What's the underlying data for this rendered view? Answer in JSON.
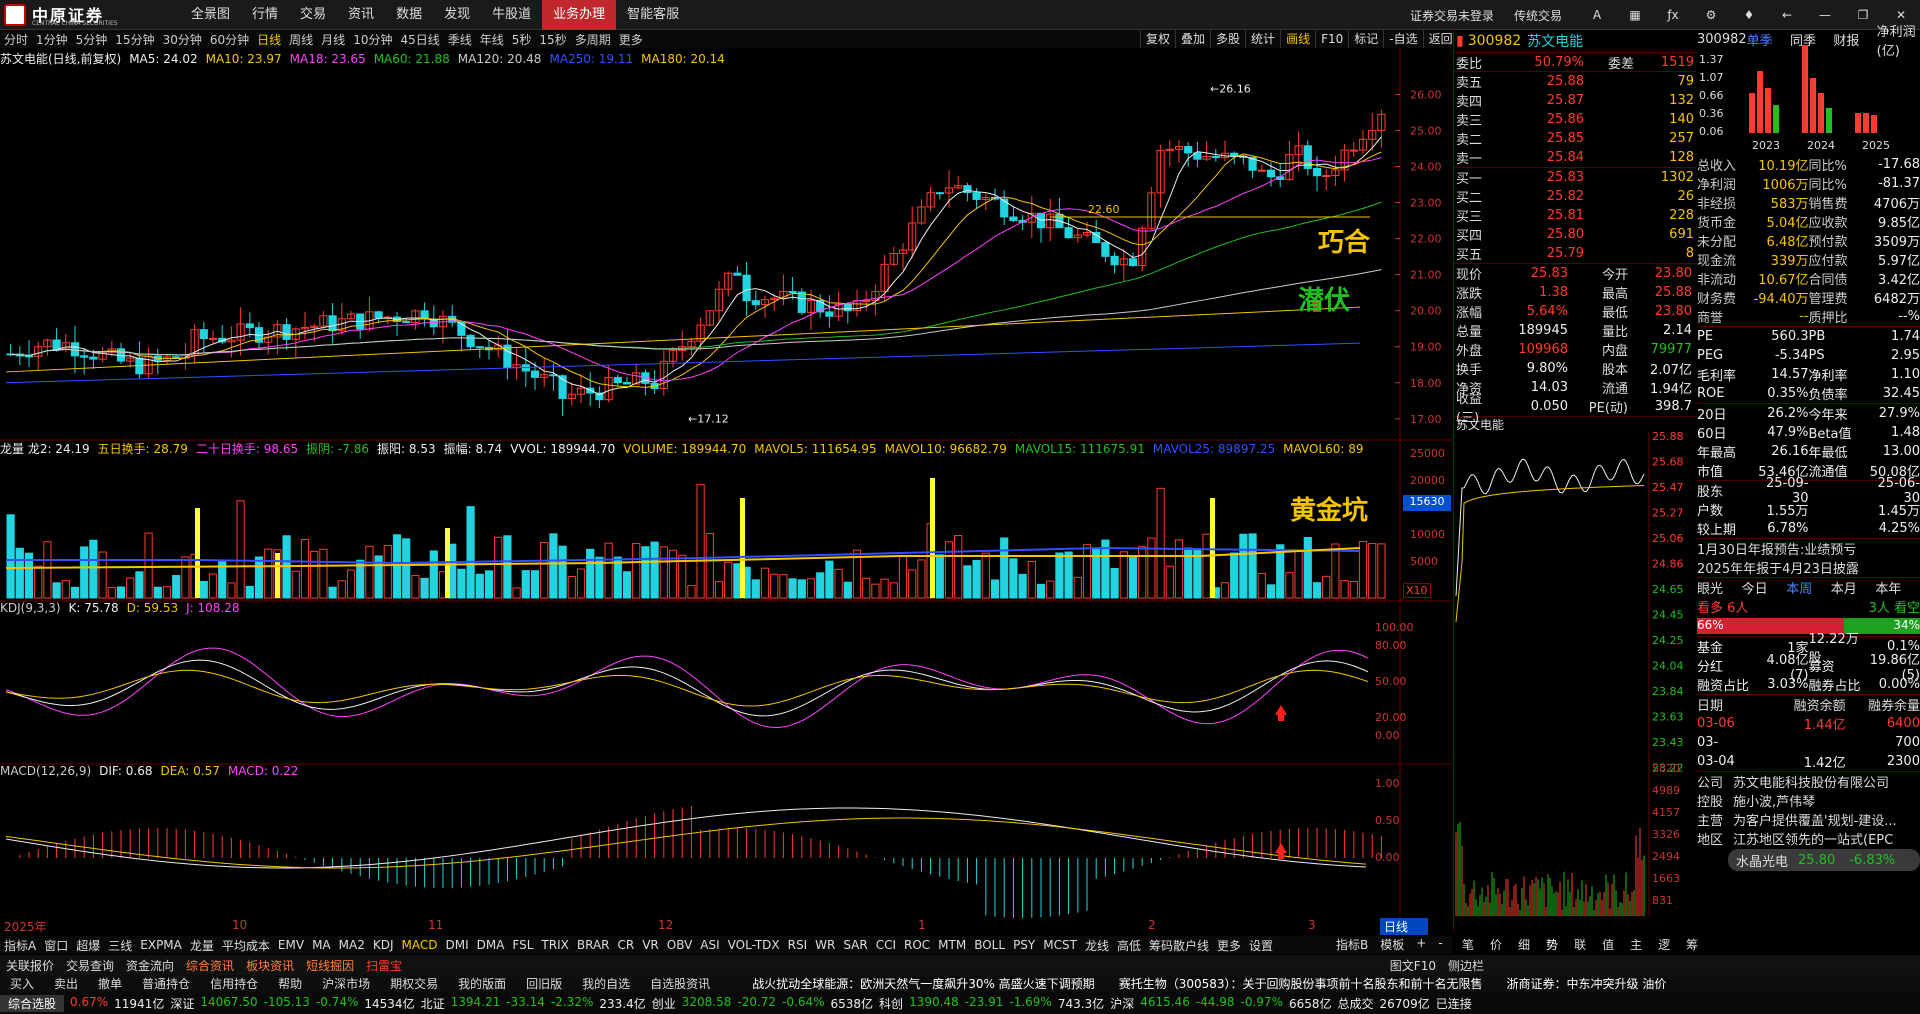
{
  "app": {
    "brand": "中原证券",
    "brand_en": "CENTRAL CHINA SECURITIES"
  },
  "menu": [
    "全景图",
    "行情",
    "交易",
    "资讯",
    "数据",
    "发现",
    "牛股道",
    "业务办理",
    "智能客服"
  ],
  "menu_active": 7,
  "top_right": {
    "login": "证券交易未登录",
    "trad": "传统交易",
    "icons": [
      "font-size-icon",
      "grid-icon",
      "formula-icon",
      "settings-icon",
      "theme-icon",
      "back-icon",
      "minimize-icon",
      "restore-icon",
      "close-icon"
    ]
  },
  "periods": [
    "分时",
    "1分钟",
    "5分钟",
    "15分钟",
    "30分钟",
    "60分钟",
    "日线",
    "周线",
    "月线",
    "10分钟",
    "45日线",
    "季线",
    "年线",
    "5秒",
    "15秒",
    "多周期",
    "更多"
  ],
  "period_active": "日线",
  "toolbtns": [
    "复权",
    "叠加",
    "多股",
    "统计",
    "画线",
    "F10",
    "标记",
    "-自选",
    "返回"
  ],
  "ma_line": {
    "title": "苏文电能(日线,前复权)",
    "items": [
      {
        "t": "MA5: 24.02",
        "c": "#eee"
      },
      {
        "t": "MA10: 23.97",
        "c": "#f5c400"
      },
      {
        "t": "MA18: 23.65",
        "c": "#ff40ff"
      },
      {
        "t": "MA60: 21.88",
        "c": "#20c020"
      },
      {
        "t": "MA120: 20.48",
        "c": "#ccc"
      },
      {
        "t": "MA250: 19.11",
        "c": "#3050ff"
      },
      {
        "t": "MA180: 20.14",
        "c": "#f5c400"
      }
    ]
  },
  "price_axis": [
    "26.00",
    "25.00",
    "24.00",
    "23.00",
    "22.00",
    "21.00",
    "20.00",
    "19.00",
    "18.00",
    "17.00"
  ],
  "annotations": {
    "high": "26.16",
    "low": "17.12",
    "mid": "22.60",
    "qiaohe": "巧合",
    "qianfu": "潜伏",
    "huangjinkeng": "黄金坑",
    "vol_mark": "15630",
    "x10": "X10"
  },
  "vol_line": {
    "items": [
      {
        "t": "龙量 龙2: 24.19",
        "c": "#eee"
      },
      {
        "t": "五日换手: 28.79",
        "c": "#f5c400"
      },
      {
        "t": "二十日换手: 98.65",
        "c": "#ff40ff"
      },
      {
        "t": "振阴: -7.86",
        "c": "#20c020"
      },
      {
        "t": "振阳: 8.53",
        "c": "#eee"
      },
      {
        "t": "振幅: 8.74",
        "c": "#eee"
      },
      {
        "t": "VVOL: 189944.70",
        "c": "#eee"
      },
      {
        "t": "VOLUME: 189944.70",
        "c": "#f5c400"
      },
      {
        "t": "MAVOL5: 111654.95",
        "c": "#f5c400"
      },
      {
        "t": "MAVOL10: 96682.79",
        "c": "#f5c400"
      },
      {
        "t": "MAVOL15: 111675.91",
        "c": "#20c020"
      },
      {
        "t": "MAVOL25: 89897.25",
        "c": "#3050ff"
      },
      {
        "t": "MAVOL60: 89",
        "c": "#f5c400"
      }
    ]
  },
  "vol_axis": [
    "25000",
    "20000",
    "15000",
    "10000",
    "5000"
  ],
  "kdj_line": {
    "items": [
      {
        "t": "KDJ(9,3,3)",
        "c": "#ccc"
      },
      {
        "t": "K: 75.78",
        "c": "#eee"
      },
      {
        "t": "D: 59.53",
        "c": "#f5c400"
      },
      {
        "t": "J: 108.28",
        "c": "#ff40ff"
      }
    ]
  },
  "kdj_axis": [
    "100.00",
    "80.00",
    "50.00",
    "20.00",
    "0.00"
  ],
  "macd_line": {
    "items": [
      {
        "t": "MACD(12,26,9)",
        "c": "#ccc"
      },
      {
        "t": "DIF: 0.68",
        "c": "#eee"
      },
      {
        "t": "DEA: 0.57",
        "c": "#f5c400"
      },
      {
        "t": "MACD: 0.22",
        "c": "#ff40ff"
      }
    ]
  },
  "macd_axis": [
    "1.00",
    "0.50",
    "0.00"
  ],
  "time_axis": [
    "2025年",
    "10",
    "11",
    "12",
    "1",
    "2",
    "3"
  ],
  "stock": {
    "code": "300982",
    "name": "苏文电能"
  },
  "order": {
    "weibi_l": "委比",
    "weibi": "50.79%",
    "weicha_l": "委差",
    "weicha": "1519",
    "sell": [
      [
        "卖五",
        "25.88",
        "79"
      ],
      [
        "卖四",
        "25.87",
        "132"
      ],
      [
        "卖三",
        "25.86",
        "140"
      ],
      [
        "卖二",
        "25.85",
        "257"
      ],
      [
        "卖一",
        "25.84",
        "128"
      ]
    ],
    "buy": [
      [
        "买一",
        "25.83",
        "1302"
      ],
      [
        "买二",
        "25.82",
        "26"
      ],
      [
        "买三",
        "25.81",
        "228"
      ],
      [
        "买四",
        "25.80",
        "691"
      ],
      [
        "买五",
        "25.79",
        "8"
      ]
    ]
  },
  "stats": [
    [
      "现价",
      "25.83",
      "今开",
      "23.80"
    ],
    [
      "涨跌",
      "1.38",
      "最高",
      "25.88"
    ],
    [
      "涨幅",
      "5.64%",
      "最低",
      "23.80"
    ],
    [
      "总量",
      "189945",
      "量比",
      "2.14"
    ],
    [
      "外盘",
      "109968",
      "内盘",
      "79977"
    ],
    [
      "换手",
      "9.80%",
      "股本",
      "2.07亿"
    ],
    [
      "净资",
      "14.03",
      "流通",
      "1.94亿"
    ],
    [
      "收益(三)",
      "0.050",
      "PE(动)",
      "398.7"
    ]
  ],
  "intraday": {
    "title": "苏文电能",
    "axis": [
      "25.88",
      "25.68",
      "25.47",
      "25.27",
      "25.06",
      "24.86",
      "24.65",
      "24.45",
      "24.25",
      "24.04",
      "23.84",
      "23.63",
      "23.43",
      "23.22"
    ],
    "vol_axis": [
      "5820",
      "4989",
      "4157",
      "3326",
      "2494",
      "1663",
      "831"
    ]
  },
  "fin": {
    "code": "300982",
    "tabs": [
      "单季",
      "同季",
      "财报",
      "净利润(亿)"
    ],
    "chart_y": [
      "1.37",
      "1.07",
      "0.66",
      "0.36",
      "0.06"
    ],
    "chart_x": [
      "2023",
      "2024",
      "2025"
    ],
    "rows1": [
      [
        "总收入",
        "10.19亿",
        "同比%",
        "-17.68"
      ],
      [
        "净利润",
        "1006万",
        "同比%",
        "-81.37"
      ],
      [
        "非经损",
        "583万",
        "销售费",
        "4706万"
      ],
      [
        "货币金",
        "5.04亿",
        "应收款",
        "9.85亿"
      ],
      [
        "未分配",
        "6.48亿",
        "预付款",
        "3509万"
      ],
      [
        "现金流",
        "339万",
        "应付款",
        "5.97亿"
      ],
      [
        "非流动",
        "10.67亿",
        "合同债",
        "3.42亿"
      ],
      [
        "财务费",
        "-94.40万",
        "管理费",
        "6482万"
      ],
      [
        "商誉",
        "--",
        "质押比",
        "--%"
      ]
    ],
    "rows2": [
      [
        "PE",
        "560.3",
        "PB",
        "1.74"
      ],
      [
        "PEG",
        "-5.34",
        "PS",
        "2.95"
      ],
      [
        "毛利率",
        "14.57",
        "净利率",
        "1.10"
      ],
      [
        "ROE",
        "0.35%",
        "负债率",
        "32.45"
      ]
    ],
    "rows3": [
      [
        "20日",
        "26.2%",
        "今年来",
        "27.9%"
      ],
      [
        "60日",
        "47.9%",
        "Beta值",
        "1.48"
      ],
      [
        "年最高",
        "26.16",
        "年最低",
        "13.00"
      ],
      [
        "市值",
        "53.46亿",
        "流通值",
        "50.08亿"
      ]
    ],
    "rows4": [
      [
        "股东",
        "25-09-30",
        "",
        "25-06-30"
      ],
      [
        "户数",
        "1.55万",
        "",
        "1.45万"
      ],
      [
        "较上期",
        "6.78%",
        "",
        "4.25%"
      ]
    ],
    "notice": [
      "1月30日年报预告:业绩预亏",
      "2025年年报于4月23日披露"
    ],
    "yanguang": {
      "label": "眼光",
      "tabs": [
        "今日",
        "本周",
        "本月",
        "本年"
      ],
      "kanduo": "看多 6人",
      "kankong": "3人 看空",
      "pct_up": "66%",
      "pct_down": "34%",
      "pct_up_val": 66
    },
    "rows5": [
      [
        "基金",
        "1家",
        "12.22万股",
        "0.1%"
      ],
      [
        "分红",
        "4.08亿(7)",
        "募资",
        "19.86亿(5)"
      ],
      [
        "融资占比",
        "3.03%",
        "融券占比",
        "0.00%"
      ]
    ],
    "margin_head": [
      "日期",
      "融资余额",
      "融券余量"
    ],
    "margin": [
      [
        "03-06",
        "1.44亿",
        "6400"
      ],
      [
        "03-",
        "",
        "700"
      ],
      [
        "03-04",
        "1.42亿",
        "2300"
      ]
    ],
    "popup": {
      "name": "水晶光电",
      "price": "25.80",
      "chg": "-6.83%"
    },
    "company": [
      [
        "公司",
        "苏文电能科技股份有限公司"
      ],
      [
        "控股",
        "施小波,芦伟琴"
      ],
      [
        "主营",
        "为客户提供覆盖'规划-建设..."
      ],
      [
        "地区",
        "江苏地区领先的一站式(EPC"
      ]
    ]
  },
  "bottom_tabs": [
    "指标A",
    "窗口",
    "超爆",
    "三线",
    "EXPMA",
    "龙量",
    "平均成本",
    "EMV",
    "MA",
    "MA2",
    "KDJ",
    "MACD",
    "DMI",
    "DMA",
    "FSL",
    "TRIX",
    "BRAR",
    "CR",
    "VR",
    "OBV",
    "ASI",
    "VOL-TDX",
    "RSI",
    "WR",
    "SAR",
    "CCI",
    "ROC",
    "MTM",
    "BOLL",
    "PSY",
    "MCST",
    "龙线",
    "高低",
    "筹码散户线",
    "更多",
    "设置"
  ],
  "bottom_tab_active": "MACD",
  "bottom_right": [
    "指标B",
    "模板",
    "+",
    "-"
  ],
  "right_tabs": [
    "笔",
    "价",
    "细",
    "势",
    "联",
    "值",
    "主",
    "逻",
    "筹"
  ],
  "func_links": [
    "关联报价",
    "交易查询",
    "资金流向",
    "综合资讯",
    "板块资讯",
    "短线掘因",
    "扫雷宝"
  ],
  "func_right": [
    "图文F10",
    "侧边栏"
  ],
  "toolbar2": [
    "买入",
    "卖出",
    "撤单",
    "普通持仓",
    "信用持仓",
    "帮助",
    "沪深市场",
    "期权交易",
    "我的版面",
    "回旧版",
    "我的自选",
    "自选股资讯"
  ],
  "news": [
    "战火扰动全球能源：欧洲天然气一度飙升30% 高盛火速下调预期",
    "赛托生物（300583）：关于回购股份事项前十名股东和前十名无限售",
    "浙商证券：中东冲突升级 油价"
  ],
  "day_label": "日线",
  "status": {
    "label": "综合选股",
    "items": [
      {
        "t": "0.67%",
        "c": "#ff3b30"
      },
      {
        "t": "11941亿",
        "c": "#eee"
      },
      {
        "t": "深证",
        "c": "#eee"
      },
      {
        "t": "14067.50",
        "c": "#20c020"
      },
      {
        "t": "-105.13",
        "c": "#20c020"
      },
      {
        "t": "-0.74%",
        "c": "#20c020"
      },
      {
        "t": "14534亿",
        "c": "#eee"
      },
      {
        "t": "北证",
        "c": "#eee"
      },
      {
        "t": "1394.21",
        "c": "#20c020"
      },
      {
        "t": "-33.14",
        "c": "#20c020"
      },
      {
        "t": "-2.32%",
        "c": "#20c020"
      },
      {
        "t": "233.4亿",
        "c": "#eee"
      },
      {
        "t": "创业",
        "c": "#eee"
      },
      {
        "t": "3208.58",
        "c": "#20c020"
      },
      {
        "t": "-20.72",
        "c": "#20c020"
      },
      {
        "t": "-0.64%",
        "c": "#20c020"
      },
      {
        "t": "6538亿",
        "c": "#eee"
      },
      {
        "t": "科创",
        "c": "#eee"
      },
      {
        "t": "1390.48",
        "c": "#20c020"
      },
      {
        "t": "-23.91",
        "c": "#20c020"
      },
      {
        "t": "-1.69%",
        "c": "#20c020"
      },
      {
        "t": "743.3亿",
        "c": "#eee"
      },
      {
        "t": "沪深",
        "c": "#eee"
      },
      {
        "t": "4615.46",
        "c": "#20c020"
      },
      {
        "t": "-44.98",
        "c": "#20c020"
      },
      {
        "t": "-0.97%",
        "c": "#20c020"
      },
      {
        "t": "6658亿",
        "c": "#eee"
      },
      {
        "t": "总成交",
        "c": "#eee"
      },
      {
        "t": "26709亿",
        "c": "#eee"
      },
      {
        "t": "已连接",
        "c": "#eee"
      }
    ]
  }
}
